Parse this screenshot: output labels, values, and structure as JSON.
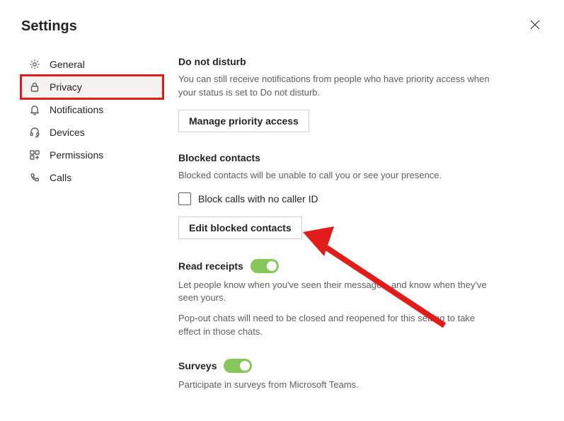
{
  "title": "Settings",
  "sidebar": {
    "items": [
      {
        "label": "General"
      },
      {
        "label": "Privacy"
      },
      {
        "label": "Notifications"
      },
      {
        "label": "Devices"
      },
      {
        "label": "Permissions"
      },
      {
        "label": "Calls"
      }
    ]
  },
  "sections": {
    "dnd": {
      "title": "Do not disturb",
      "desc": "You can still receive notifications from people who have priority access when your status is set to Do not disturb.",
      "button": "Manage priority access"
    },
    "blocked": {
      "title": "Blocked contacts",
      "desc": "Blocked contacts will be unable to call you or see your presence.",
      "checkbox_label": "Block calls with no caller ID",
      "button": "Edit blocked contacts"
    },
    "read": {
      "title": "Read receipts",
      "desc1": "Let people know when you've seen their messages, and know when they've seen yours.",
      "desc2": "Pop-out chats will need to be closed and reopened for this setting to take effect in those chats."
    },
    "surveys": {
      "title": "Surveys",
      "desc": "Participate in surveys from Microsoft Teams."
    }
  }
}
